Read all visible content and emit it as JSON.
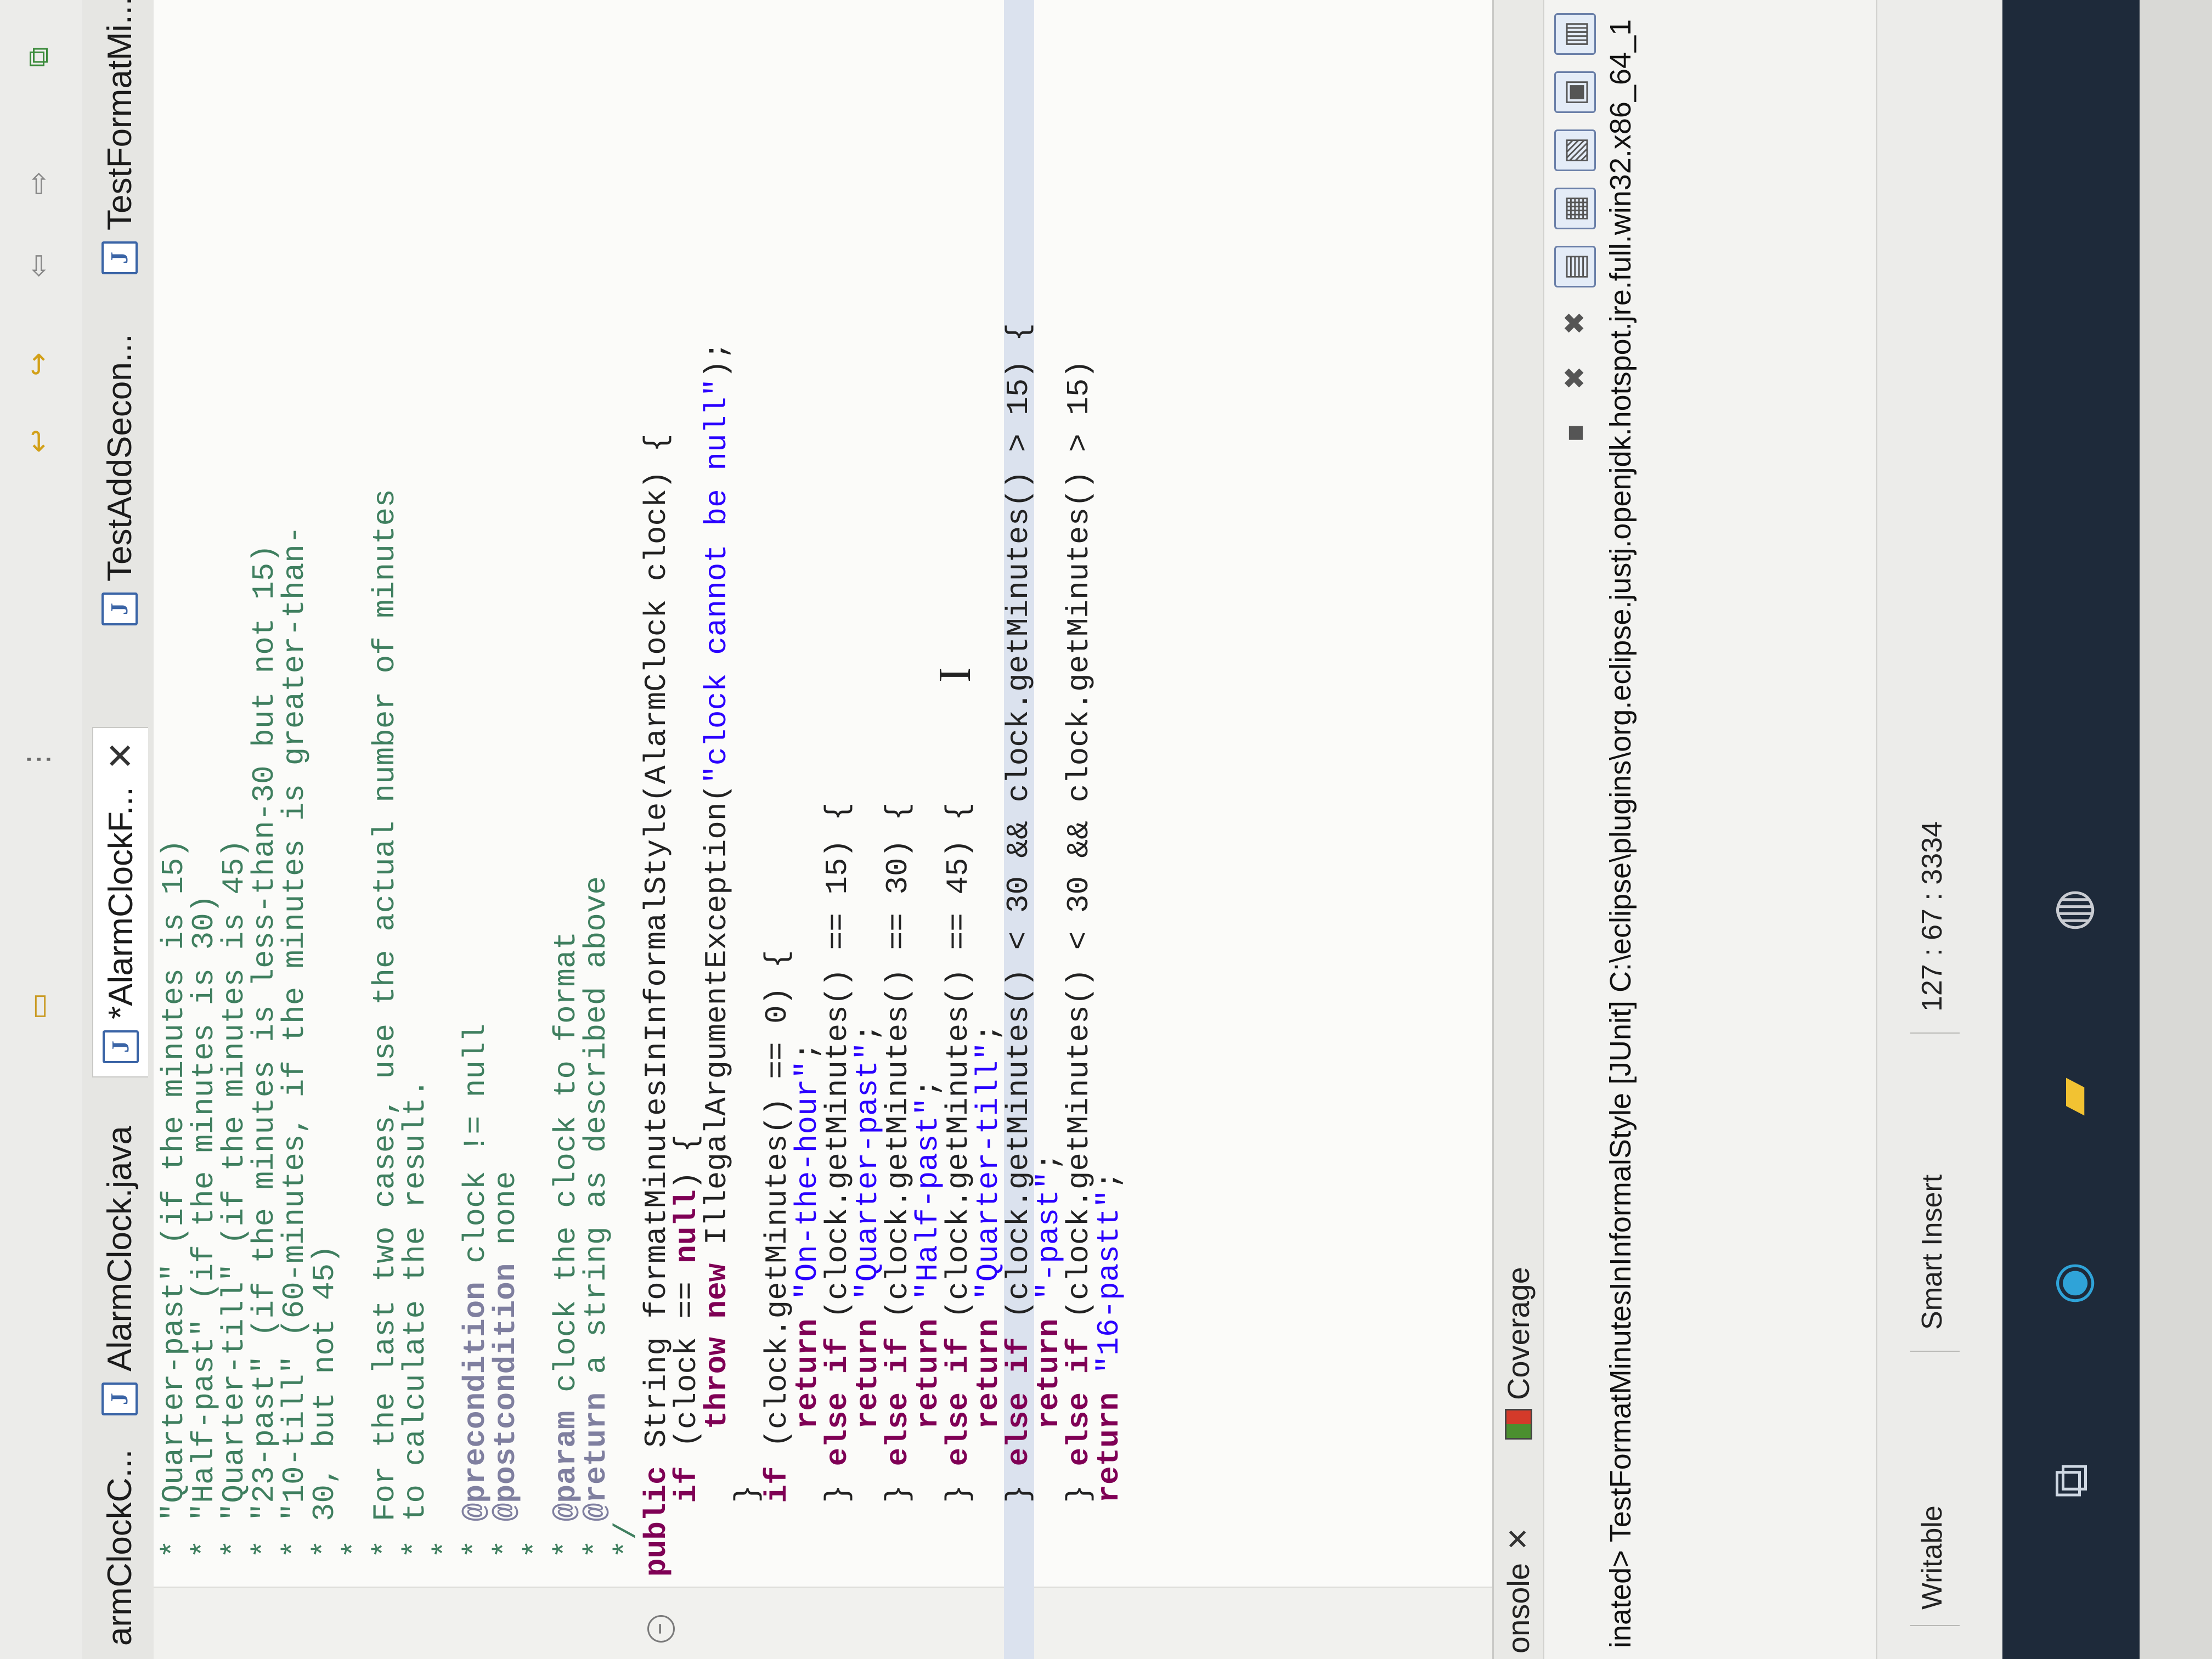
{
  "tabs": [
    {
      "label": "armClockC...",
      "active": false
    },
    {
      "label": "AlarmClock.java",
      "active": false
    },
    {
      "label": "*AlarmClockF...",
      "active": true
    },
    {
      "label": "TestAddSecon...",
      "active": false
    },
    {
      "label": "TestFormatMi...",
      "active": false
    }
  ],
  "code_lines": [
    {
      "parts": [
        {
          "c": "cm",
          "t": " * \"Quarter-past\" (if the minutes is 15)"
        }
      ]
    },
    {
      "parts": [
        {
          "c": "cm",
          "t": " * \"Half-past\" (if the minutes is 30)"
        }
      ]
    },
    {
      "parts": [
        {
          "c": "cm",
          "t": " * \"Quarter-till\" (if the minutes is 45)"
        }
      ]
    },
    {
      "parts": [
        {
          "c": "cm",
          "t": " * \"23-past\" (if the minutes is less-than-30 but not 15)"
        }
      ]
    },
    {
      "parts": [
        {
          "c": "cm",
          "t": " * \"10-till\" (60-minutes, if the minutes is greater-than-"
        }
      ]
    },
    {
      "parts": [
        {
          "c": "cm",
          "t": " * 30, but not 45)"
        }
      ]
    },
    {
      "parts": [
        {
          "c": "cm",
          "t": " *"
        }
      ]
    },
    {
      "parts": [
        {
          "c": "cm",
          "t": " * For the last two cases, use the actual number of minutes"
        }
      ]
    },
    {
      "parts": [
        {
          "c": "cm",
          "t": " * to calculate the result."
        }
      ]
    },
    {
      "parts": [
        {
          "c": "cm",
          "t": " *"
        }
      ]
    },
    {
      "parts": [
        {
          "c": "cm",
          "t": " * "
        },
        {
          "c": "tg",
          "t": "@precondition"
        },
        {
          "c": "cm",
          "t": " clock != null"
        }
      ]
    },
    {
      "parts": [
        {
          "c": "cm",
          "t": " * "
        },
        {
          "c": "tg",
          "t": "@postcondition"
        },
        {
          "c": "cm",
          "t": " none"
        }
      ]
    },
    {
      "parts": [
        {
          "c": "cm",
          "t": " *"
        }
      ]
    },
    {
      "parts": [
        {
          "c": "cm",
          "t": " * "
        },
        {
          "c": "tg",
          "t": "@param"
        },
        {
          "c": "cm",
          "t": " clock the clock to format"
        }
      ]
    },
    {
      "parts": [
        {
          "c": "cm",
          "t": " * "
        },
        {
          "c": "tg",
          "t": "@return"
        },
        {
          "c": "cm",
          "t": " a string as described above"
        }
      ]
    },
    {
      "parts": [
        {
          "c": "cm",
          "t": " */"
        }
      ]
    },
    {
      "parts": [
        {
          "c": "kw",
          "t": "public"
        },
        {
          "c": "",
          "t": " String formatMinutesInInformalStyle(AlarmClock clock) {"
        }
      ]
    },
    {
      "parts": [
        {
          "c": "",
          "t": "    "
        },
        {
          "c": "kw",
          "t": "if"
        },
        {
          "c": "",
          "t": " (clock == "
        },
        {
          "c": "kw",
          "t": "null"
        },
        {
          "c": "",
          "t": ") {"
        }
      ]
    },
    {
      "parts": [
        {
          "c": "",
          "t": "        "
        },
        {
          "c": "kw",
          "t": "throw new"
        },
        {
          "c": "",
          "t": " IllegalArgumentException("
        },
        {
          "c": "st",
          "t": "\"clock cannot be null\""
        },
        {
          "c": "",
          "t": ");"
        }
      ]
    },
    {
      "parts": [
        {
          "c": "",
          "t": "    }"
        }
      ]
    },
    {
      "parts": [
        {
          "c": "",
          "t": "    "
        },
        {
          "c": "kw",
          "t": "if"
        },
        {
          "c": "",
          "t": " (clock.getMinutes() == 0) {"
        }
      ]
    },
    {
      "parts": [
        {
          "c": "",
          "t": "        "
        },
        {
          "c": "kw",
          "t": "return"
        },
        {
          "c": "",
          "t": " "
        },
        {
          "c": "st",
          "t": "\"On-the-hour\""
        },
        {
          "c": "",
          "t": ";"
        }
      ]
    },
    {
      "parts": [
        {
          "c": "",
          "t": "    } "
        },
        {
          "c": "kw",
          "t": "else if"
        },
        {
          "c": "",
          "t": " (clock.getMinutes() == 15) {"
        }
      ]
    },
    {
      "parts": [
        {
          "c": "",
          "t": "        "
        },
        {
          "c": "kw",
          "t": "return"
        },
        {
          "c": "",
          "t": " "
        },
        {
          "c": "st",
          "t": "\"Quarter-past\""
        },
        {
          "c": "",
          "t": ";"
        }
      ]
    },
    {
      "parts": [
        {
          "c": "",
          "t": "    } "
        },
        {
          "c": "kw",
          "t": "else if"
        },
        {
          "c": "",
          "t": " (clock.getMinutes() == 30) {"
        }
      ]
    },
    {
      "parts": [
        {
          "c": "",
          "t": "        "
        },
        {
          "c": "kw",
          "t": "return"
        },
        {
          "c": "",
          "t": " "
        },
        {
          "c": "st",
          "t": "\"Half-past\""
        },
        {
          "c": "",
          "t": ";"
        }
      ]
    },
    {
      "parts": [
        {
          "c": "",
          "t": "    } "
        },
        {
          "c": "kw",
          "t": "else if"
        },
        {
          "c": "",
          "t": " (clock.getMinutes() == 45) {"
        }
      ]
    },
    {
      "parts": [
        {
          "c": "",
          "t": "        "
        },
        {
          "c": "kw",
          "t": "return"
        },
        {
          "c": "",
          "t": " "
        },
        {
          "c": "st",
          "t": "\"Quarter-till\""
        },
        {
          "c": "",
          "t": ";"
        }
      ]
    },
    {
      "parts": [
        {
          "c": "",
          "t": "    } "
        },
        {
          "c": "kw",
          "t": "else if"
        },
        {
          "c": "",
          "t": " (clock.getMinutes() < 30 && clock.getMinutes() > 15) {"
        }
      ],
      "highlight": true
    },
    {
      "parts": [
        {
          "c": "",
          "t": "        "
        },
        {
          "c": "kw",
          "t": "return"
        },
        {
          "c": "",
          "t": " "
        },
        {
          "c": "st",
          "t": "\"-past\""
        },
        {
          "c": "",
          "t": ";"
        }
      ]
    },
    {
      "parts": [
        {
          "c": "",
          "t": "    } "
        },
        {
          "c": "kw",
          "t": "else if"
        },
        {
          "c": "",
          "t": " (clock.getMinutes() < 30 && clock.getMinutes() > 15)"
        }
      ]
    },
    {
      "parts": [
        {
          "c": "",
          "t": "    "
        },
        {
          "c": "kw",
          "t": "return"
        },
        {
          "c": "",
          "t": " "
        },
        {
          "c": "st",
          "t": "\"16-pastt\""
        },
        {
          "c": "",
          "t": ";"
        }
      ]
    }
  ],
  "console": {
    "tab_console": "onsole",
    "tab_coverage": "Coverage",
    "command": "inated> TestFormatMinutesInInformalStyle [JUnit] C:\\eclipse\\plugins\\org.eclipse.justj.openjdk.hotspot.jre.full.win32.x86_64_1"
  },
  "status": {
    "writable": "Writable",
    "insert_mode": "Smart Insert",
    "position": "127 : 67 : 3334"
  },
  "colors": {
    "comment": "#3f7f5f",
    "keyword": "#7f0055",
    "string": "#2a00ff",
    "tag": "#7f7f9f",
    "highlight_line": "#dbe2ee"
  }
}
